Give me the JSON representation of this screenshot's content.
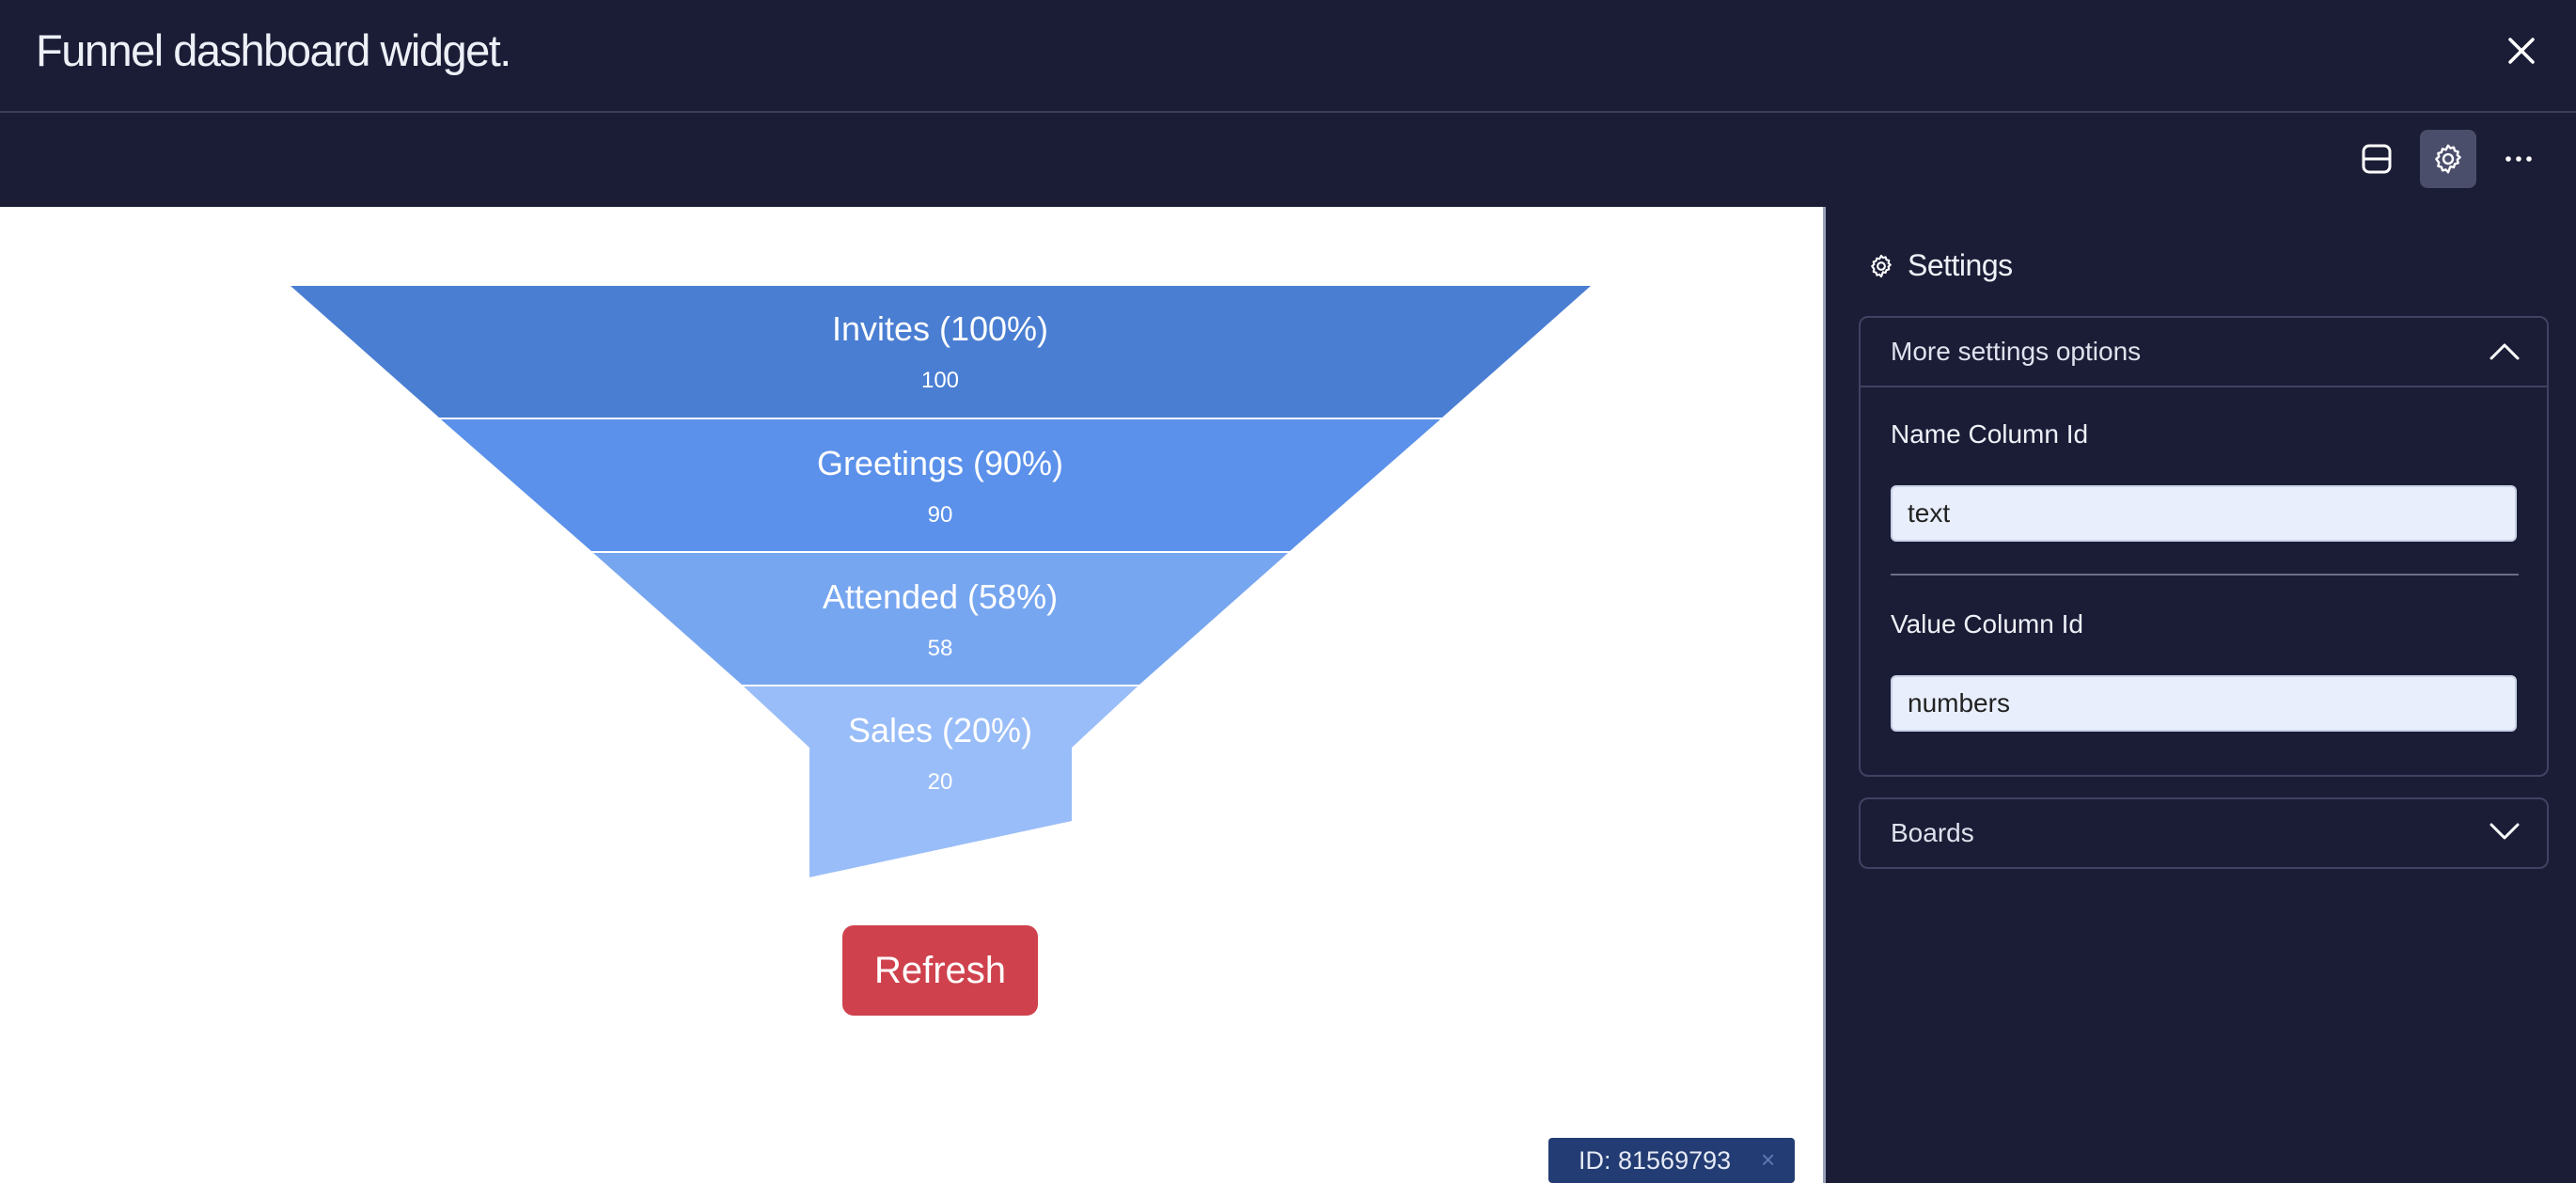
{
  "window": {
    "title": "Funnel dashboard widget.",
    "close_icon": "close-icon"
  },
  "toolbar": {
    "buttons": [
      {
        "icon": "panel-layout-icon",
        "active": false
      },
      {
        "icon": "gear-icon",
        "active": true
      },
      {
        "icon": "more-options-icon",
        "active": false
      }
    ]
  },
  "funnel": {
    "colors": [
      "#4a7ed2",
      "#5b91ea",
      "#77a6f0",
      "#99bdf8"
    ],
    "stages": [
      {
        "label": "Invites (100%)",
        "value": "100",
        "percent": 100
      },
      {
        "label": "Greetings (90%)",
        "value": "90",
        "percent": 90
      },
      {
        "label": "Attended (58%)",
        "value": "58",
        "percent": 58
      },
      {
        "label": "Sales (20%)",
        "value": "20",
        "percent": 20
      }
    ]
  },
  "refresh_button": {
    "label": "Refresh",
    "color": "#cf424d"
  },
  "id_badge": {
    "text": "ID: 81569793",
    "close": "×"
  },
  "settings": {
    "title": "Settings",
    "more_options": {
      "label": "More settings options",
      "expanded": true,
      "name_column": {
        "label": "Name Column Id",
        "value": "text"
      },
      "value_column": {
        "label": "Value Column Id",
        "value": "numbers"
      }
    },
    "boards": {
      "label": "Boards",
      "expanded": false
    }
  }
}
